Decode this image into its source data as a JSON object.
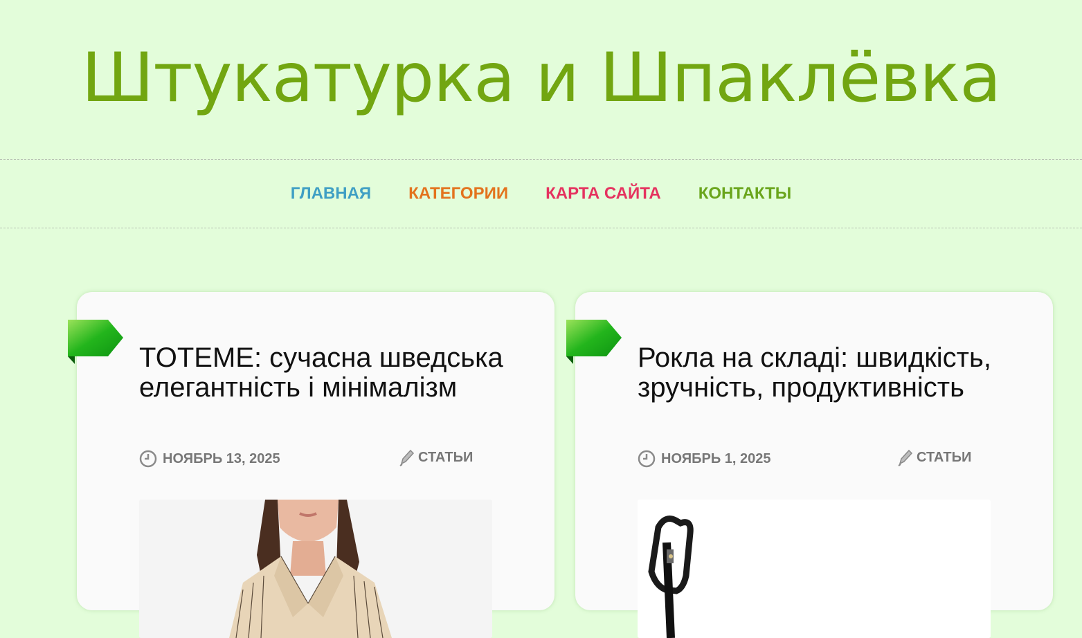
{
  "site": {
    "title": "Штукатурка и Шпаклёвка"
  },
  "nav": {
    "items": [
      {
        "label": "ГЛАВНАЯ",
        "color": "#3f9fc4"
      },
      {
        "label": "КАТЕГОРИИ",
        "color": "#e3731d"
      },
      {
        "label": "КАРТА САЙТА",
        "color": "#e5325f"
      },
      {
        "label": "КОНТАКТЫ",
        "color": "#6aa51c"
      }
    ]
  },
  "posts": [
    {
      "title": "TOTEME: сучасна шведська елегантність і мінімалізм",
      "date": "НОЯБРЬ 13, 2025",
      "category": "СТАТЬИ",
      "image": "woman-in-striped-jacket-photo"
    },
    {
      "title": "Рокла на складі: швидкість, зручність, продуктивність",
      "date": "НОЯБРЬ 1, 2025",
      "category": "СТАТЬИ",
      "image": "pallet-jack-handle-photo"
    }
  ],
  "icons": {
    "date": "clock-icon",
    "category": "pencil-icon",
    "ribbon": "green-ribbon-icon"
  },
  "colors": {
    "background": "#e3fdda",
    "title": "#72a611",
    "ribbon": "#2fb51d"
  }
}
